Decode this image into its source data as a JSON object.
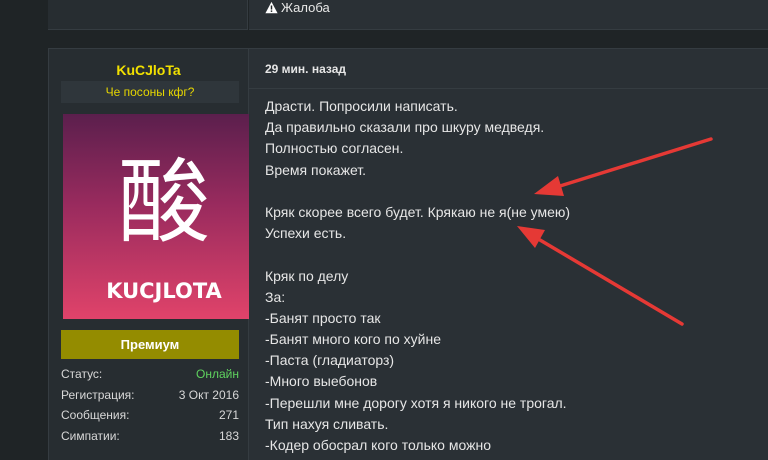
{
  "prev_post": {
    "report_label": "Жалоба"
  },
  "post": {
    "username": "KuCJloTa",
    "user_title": "Че посоны кфг?",
    "avatar": {
      "glyph": "酸",
      "caption": "KUCJLOTA"
    },
    "premium_label": "Премиум",
    "stats": [
      {
        "label": "Статус:",
        "value": "Онлайн"
      },
      {
        "label": "Регистрация:",
        "value": "3 Окт 2016"
      },
      {
        "label": "Сообщения:",
        "value": "271"
      },
      {
        "label": "Симпатии:",
        "value": "183"
      }
    ],
    "timestamp": "29 мин. назад",
    "lines": [
      "Драсти. Попросили написать.",
      "Да правильно сказали про шкуру медведя.",
      "Полностью согласен.",
      "Время покажет.",
      "",
      "Кряк скорее всего будет. Крякаю не я(не умею)",
      "Успехи есть.",
      "",
      "Кряк по делу",
      "За:",
      "-Банят просто так",
      "-Банят много кого по хуйне",
      "-Паста (гладиаторз)",
      "-Много выебонов",
      "-Перешли мне дорогу хотя я никого не трогал.",
      "Тип нахуя сливать.",
      "-Кодер обосрал кого только можно"
    ]
  },
  "colors": {
    "username": "#f2e000",
    "premium_bg": "#948c00",
    "online": "#5fd35f",
    "arrow": "#e53935"
  }
}
